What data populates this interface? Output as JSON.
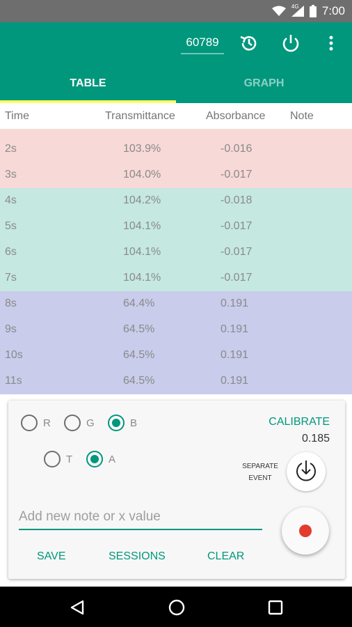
{
  "status_bar": {
    "time": "7:00",
    "network": "4G"
  },
  "app_bar": {
    "device_id": "60789"
  },
  "tabs": [
    {
      "label": "TABLE",
      "active": true
    },
    {
      "label": "GRAPH",
      "active": false
    }
  ],
  "table": {
    "headers": [
      "Time",
      "Transmittance",
      "Absorbance",
      "Note"
    ],
    "rows": [
      {
        "time": "2s",
        "transmittance": "103.9%",
        "absorbance": "-0.016",
        "note": "",
        "group": 0
      },
      {
        "time": "3s",
        "transmittance": "104.0%",
        "absorbance": "-0.017",
        "note": "",
        "group": 0
      },
      {
        "time": "4s",
        "transmittance": "104.2%",
        "absorbance": "-0.018",
        "note": "",
        "group": 1
      },
      {
        "time": "5s",
        "transmittance": "104.1%",
        "absorbance": "-0.017",
        "note": "",
        "group": 1
      },
      {
        "time": "6s",
        "transmittance": "104.1%",
        "absorbance": "-0.017",
        "note": "",
        "group": 1
      },
      {
        "time": "7s",
        "transmittance": "104.1%",
        "absorbance": "-0.017",
        "note": "",
        "group": 1
      },
      {
        "time": "8s",
        "transmittance": "64.4%",
        "absorbance": "0.191",
        "note": "",
        "group": 2
      },
      {
        "time": "9s",
        "transmittance": "64.5%",
        "absorbance": "0.191",
        "note": "",
        "group": 2
      },
      {
        "time": "10s",
        "transmittance": "64.5%",
        "absorbance": "0.191",
        "note": "",
        "group": 2
      },
      {
        "time": "11s",
        "transmittance": "64.5%",
        "absorbance": "0.191",
        "note": "",
        "group": 2
      }
    ]
  },
  "colors": {
    "primary": "#00977c",
    "tab_indicator": "#ffff66",
    "record": "#e33b2e",
    "event_groups": [
      "#f7d9d7",
      "#c5e8e1",
      "#c9cceb"
    ]
  },
  "controls": {
    "channels": [
      {
        "label": "R",
        "checked": false
      },
      {
        "label": "G",
        "checked": false
      },
      {
        "label": "B",
        "checked": true
      }
    ],
    "modes": [
      {
        "label": "T",
        "checked": false
      },
      {
        "label": "A",
        "checked": true
      }
    ],
    "calibrate_label": "CALIBRATE",
    "calibration_value": "0.185",
    "separate_event_label": "SEPARATE EVENT",
    "note_placeholder": "Add new note or x value",
    "note_value": "",
    "actions": {
      "save": "SAVE",
      "sessions": "SESSIONS",
      "clear": "CLEAR"
    }
  },
  "icons": {
    "toolbar": [
      "timer-icon",
      "power-icon",
      "overflow-menu-icon"
    ],
    "status": [
      "wifi-icon",
      "signal-icon",
      "battery-icon"
    ],
    "nav": [
      "back-icon",
      "home-icon",
      "recents-icon"
    ]
  }
}
